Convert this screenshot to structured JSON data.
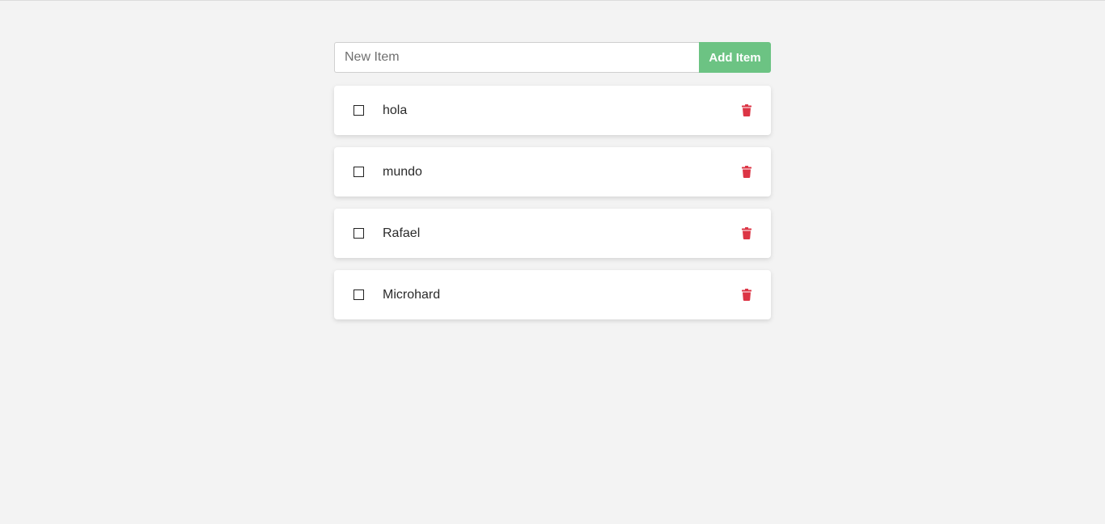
{
  "form": {
    "input_placeholder": "New Item",
    "input_value": "",
    "add_button_label": "Add Item"
  },
  "items": [
    {
      "text": "hola",
      "checked": false
    },
    {
      "text": "mundo",
      "checked": false
    },
    {
      "text": "Rafael",
      "checked": false
    },
    {
      "text": "Microhard",
      "checked": false
    }
  ],
  "icons": {
    "delete": "trash-icon",
    "checkbox": "checkbox-empty"
  },
  "colors": {
    "background": "#f3f3f3",
    "add_button": "#6cc383",
    "delete_icon": "#dc3545",
    "card": "#ffffff"
  }
}
